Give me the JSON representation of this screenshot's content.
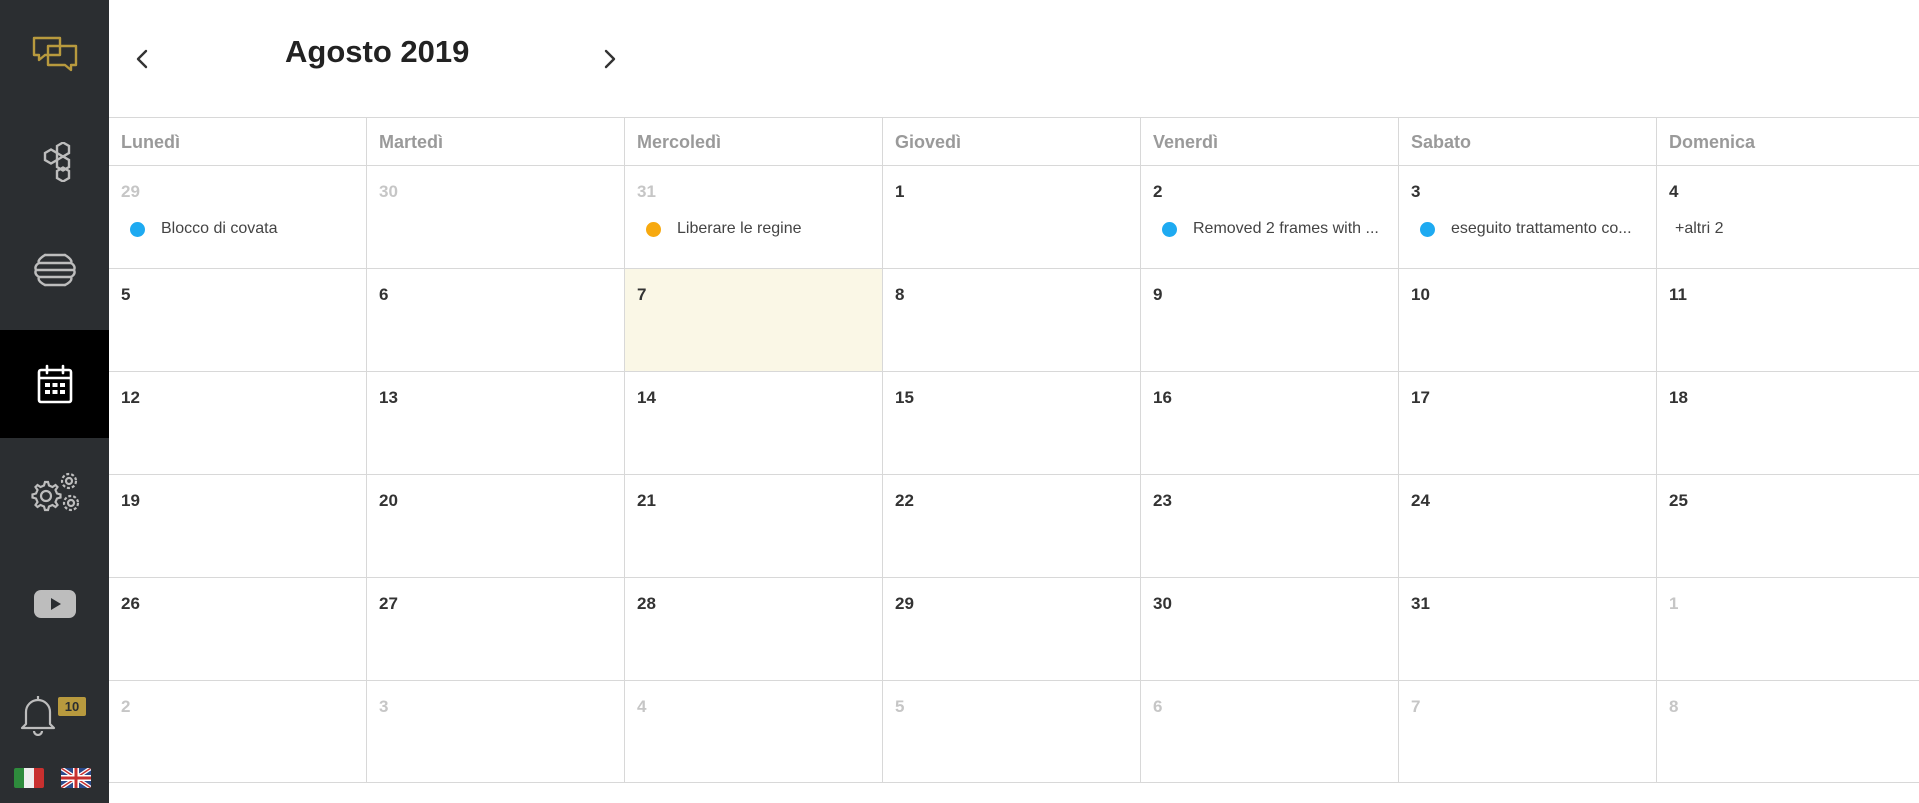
{
  "app": {
    "nav": [
      {
        "name": "chat-icon",
        "color": "#b89a3e"
      },
      {
        "name": "hives-icon",
        "color": "#bdbdbd"
      },
      {
        "name": "beehive-icon",
        "color": "#bdbdbd"
      },
      {
        "name": "calendar-icon",
        "color": "#ffffff",
        "active": true
      },
      {
        "name": "settings-icon",
        "color": "#bdbdbd"
      },
      {
        "name": "youtube-icon",
        "color": "#bdbdbd"
      },
      {
        "name": "bell-icon",
        "color": "#bdbdbd"
      }
    ],
    "notifications_count": "10",
    "languages": [
      "it",
      "en"
    ]
  },
  "calendar": {
    "month_title": "Agosto 2019",
    "prev_icon": "chevron-left-icon",
    "next_icon": "chevron-right-icon",
    "weekdays": [
      "Lunedì",
      "Martedì",
      "Mercoledì",
      "Giovedì",
      "Venerdì",
      "Sabato",
      "Domenica"
    ],
    "weeks": [
      [
        {
          "day": "29",
          "other": true,
          "event": {
            "label": "Blocco di covata",
            "color": "#1eaaf1"
          }
        },
        {
          "day": "30",
          "other": true
        },
        {
          "day": "31",
          "other": true,
          "event": {
            "label": "Liberare le regine",
            "color": "#f7a90f"
          }
        },
        {
          "day": "1"
        },
        {
          "day": "2",
          "event": {
            "label": "Removed 2 frames with ...",
            "color": "#1eaaf1"
          }
        },
        {
          "day": "3",
          "event": {
            "label": "eseguito trattamento co...",
            "color": "#1eaaf1"
          }
        },
        {
          "day": "4",
          "more": "+altri 2"
        }
      ],
      [
        {
          "day": "5"
        },
        {
          "day": "6"
        },
        {
          "day": "7",
          "today": true
        },
        {
          "day": "8"
        },
        {
          "day": "9"
        },
        {
          "day": "10"
        },
        {
          "day": "11"
        }
      ],
      [
        {
          "day": "12"
        },
        {
          "day": "13"
        },
        {
          "day": "14"
        },
        {
          "day": "15"
        },
        {
          "day": "16"
        },
        {
          "day": "17"
        },
        {
          "day": "18"
        }
      ],
      [
        {
          "day": "19"
        },
        {
          "day": "20"
        },
        {
          "day": "21"
        },
        {
          "day": "22"
        },
        {
          "day": "23"
        },
        {
          "day": "24"
        },
        {
          "day": "25"
        }
      ],
      [
        {
          "day": "26"
        },
        {
          "day": "27"
        },
        {
          "day": "28"
        },
        {
          "day": "29"
        },
        {
          "day": "30"
        },
        {
          "day": "31"
        },
        {
          "day": "1",
          "other": true
        }
      ],
      [
        {
          "day": "2",
          "other": true
        },
        {
          "day": "3",
          "other": true
        },
        {
          "day": "4",
          "other": true
        },
        {
          "day": "5",
          "other": true
        },
        {
          "day": "6",
          "other": true
        },
        {
          "day": "7",
          "other": true
        },
        {
          "day": "8",
          "other": true
        }
      ]
    ]
  }
}
